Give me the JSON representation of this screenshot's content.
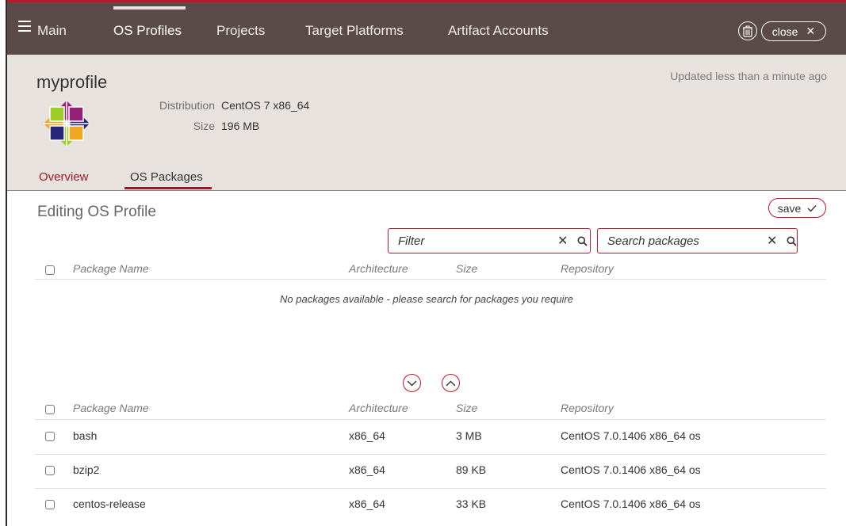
{
  "nav": {
    "items": [
      "Main",
      "OS Profiles",
      "Projects",
      "Target Platforms",
      "Artifact Accounts"
    ],
    "active": "OS Profiles",
    "close_label": "close"
  },
  "profile": {
    "name": "myprofile",
    "updated": "Updated less than a minute ago",
    "distribution_label": "Distribution",
    "distribution_value": "CentOS 7 x86_64",
    "size_label": "Size",
    "size_value": "196 MB"
  },
  "subtabs": [
    "Overview",
    "OS Packages"
  ],
  "editor": {
    "title": "Editing OS Profile",
    "save_label": "save",
    "filter_placeholder": "Filter",
    "search_placeholder": "Search packages"
  },
  "table_columns": [
    "Package Name",
    "Architecture",
    "Size",
    "Repository"
  ],
  "selected_empty_message": "No packages available - please search for packages you require",
  "available_packages": [
    {
      "name": "bash",
      "arch": "x86_64",
      "size": "3 MB",
      "repo": "CentOS 7.0.1406 x86_64 os"
    },
    {
      "name": "bzip2",
      "arch": "x86_64",
      "size": "89 KB",
      "repo": "CentOS 7.0.1406 x86_64 os"
    },
    {
      "name": "centos-release",
      "arch": "x86_64",
      "size": "33 KB",
      "repo": "CentOS 7.0.1406 x86_64 os"
    }
  ],
  "colors": {
    "topbar": "#5a4b48",
    "accent": "#c0162c",
    "header_bg": "#e8e2df"
  },
  "icons": [
    "menu-icon",
    "trash-icon",
    "close-icon",
    "centos-logo",
    "save-check-icon",
    "search-icon",
    "clear-icon",
    "chevron-down-icon",
    "chevron-up-icon"
  ]
}
